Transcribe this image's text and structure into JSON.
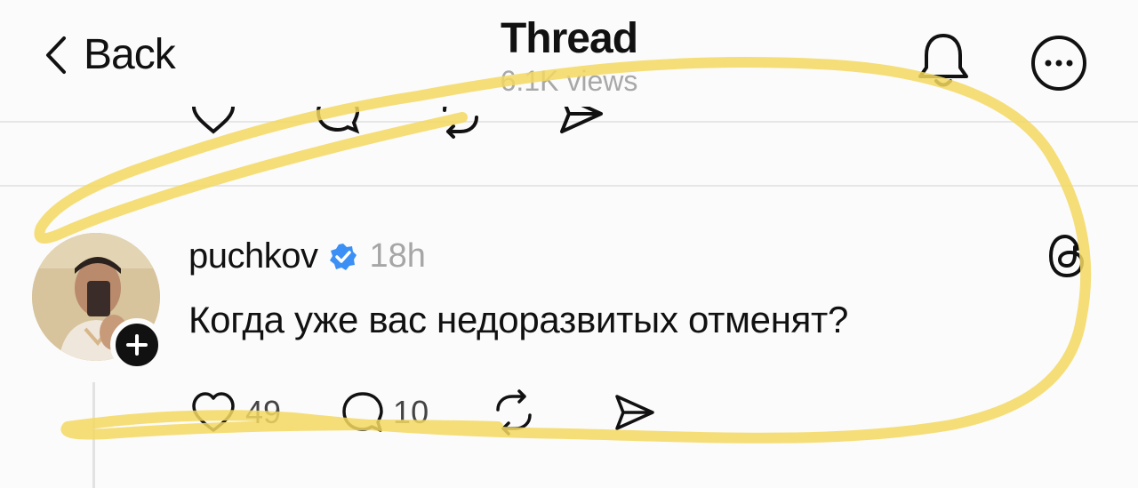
{
  "header": {
    "back_label": "Back",
    "title": "Thread",
    "views": "6.1K views"
  },
  "post": {
    "username": "puchkov",
    "verified": true,
    "time": "18h",
    "text": "Когда уже вас недоразвитых отменят?",
    "likes": "49",
    "replies": "10"
  },
  "colors": {
    "highlight": "#f3d860",
    "verified_badge": "#3b8ff5",
    "text": "#111111",
    "muted": "#a6a6a6"
  },
  "icons": {
    "back": "chevron-left-icon",
    "notifications": "bell-icon",
    "more": "more-icon",
    "threads": "threads-logo-icon",
    "like": "heart-icon",
    "reply": "comment-icon",
    "repost": "repost-icon",
    "share": "send-icon"
  }
}
